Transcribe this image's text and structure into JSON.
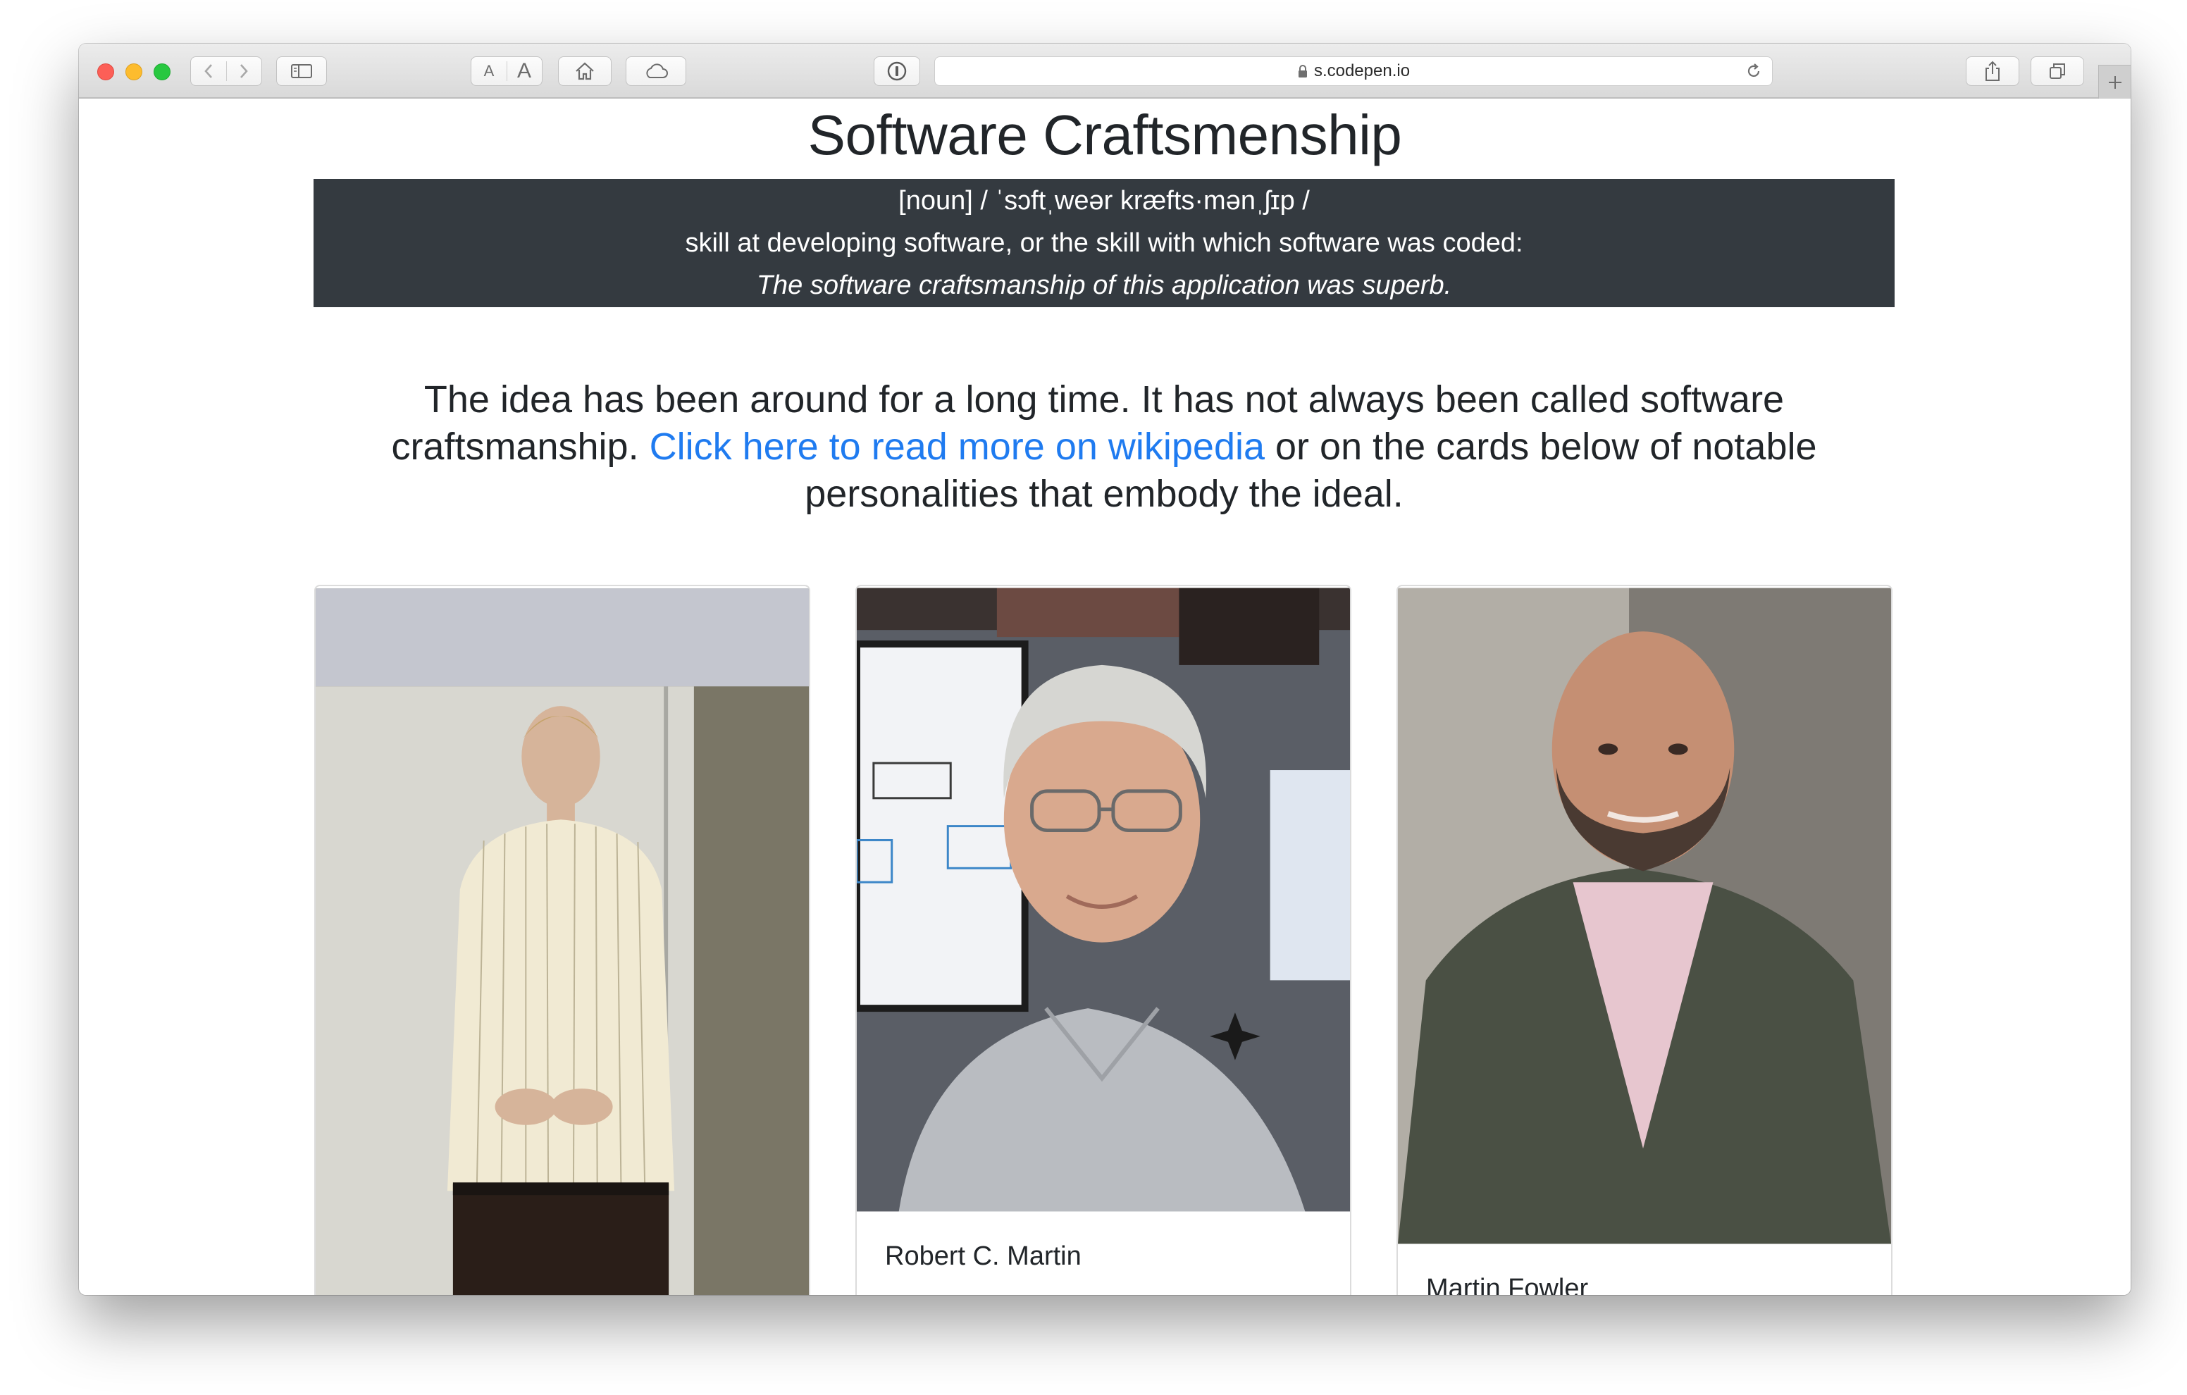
{
  "browser": {
    "url": "s.codepen.io",
    "font_smaller": "A",
    "font_larger": "A"
  },
  "page": {
    "title": "Software Craftsmenship",
    "definition": {
      "pronunciation": "[noun] / ˈsɔftˌweər kræfts·mənˌʃɪp /",
      "meaning": "skill at developing software, or the skill with which software was coded:",
      "example": "The software craftsmanship of this application was superb."
    },
    "intro": {
      "before_link": "The idea has been around for a long time. It has not always been called software craftsmanship. ",
      "link_text": "Click here to read more on wikipedia",
      "after_link": " or on the cards below of notable personalities that embody the ideal."
    },
    "cards": [
      {
        "name": ""
      },
      {
        "name": "Robert C. Martin"
      },
      {
        "name": "Martin Fowler"
      }
    ]
  },
  "colors": {
    "definition_bg": "#343a40",
    "link": "#1f7bf0",
    "text": "#212529"
  }
}
